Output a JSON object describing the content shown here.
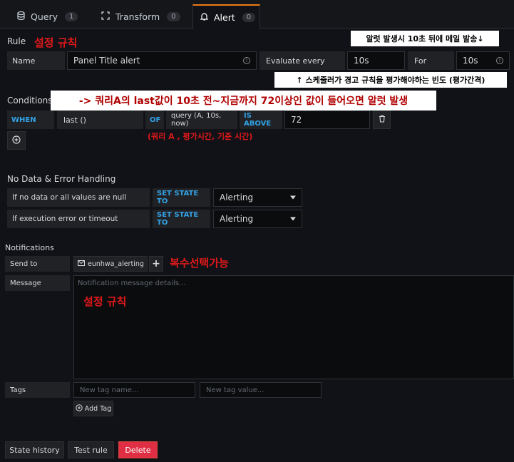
{
  "tabs": [
    {
      "label": "Query",
      "count": "1"
    },
    {
      "label": "Transform",
      "count": "0"
    },
    {
      "label": "Alert",
      "count": "0"
    }
  ],
  "rule": {
    "section_title": "Rule",
    "annotation": "설정 규칙",
    "name_label": "Name",
    "name_value": "Panel Title alert",
    "evaluate_label": "Evaluate every",
    "evaluate_value": "10s",
    "for_label": "For",
    "for_value": "10s",
    "top_note": "알럿 발생시 10초 뒤에 메일 발송↓",
    "bottom_note": "↑ 스케줄러가 경고 규칙을 평가해야하는 빈도 (평가간격)"
  },
  "conditions": {
    "section_title": "Conditions",
    "annotation": "-> 쿼리A의 last값이 10초 전~지금까지 72이상인 값이 들어오면 알럿 발생",
    "when": "WHEN",
    "reducer": "last ()",
    "of": "OF",
    "query": "query (A, 10s, now)",
    "evaluator": "IS ABOVE",
    "threshold": "72",
    "query_note": "(쿼리 A , 평가시간, 기준 시간)"
  },
  "nodata": {
    "section_title": "No Data & Error Handling",
    "rows": [
      {
        "label": "If no data or all values are null",
        "action": "SET STATE TO",
        "value": "Alerting"
      },
      {
        "label": "If execution error or timeout",
        "action": "SET STATE TO",
        "value": "Alerting"
      }
    ]
  },
  "notifications": {
    "section_title": "Notifications",
    "send_to_label": "Send to",
    "channel": "eunhwa_alerting",
    "send_note": "복수선택가능",
    "message_label": "Message",
    "message_placeholder": "Notification message details...",
    "message_note": "설정 규칙",
    "tags_label": "Tags",
    "tag_name_placeholder": "New tag name...",
    "tag_value_placeholder": "New tag value...",
    "add_tag": "Add Tag"
  },
  "footer": {
    "state_history": "State history",
    "test_rule": "Test rule",
    "delete": "Delete"
  },
  "colors": {
    "accent": "#eb7b18",
    "keyword": "#33a2e5",
    "annotation_red": "#e0191a",
    "danger": "#e02f44"
  }
}
